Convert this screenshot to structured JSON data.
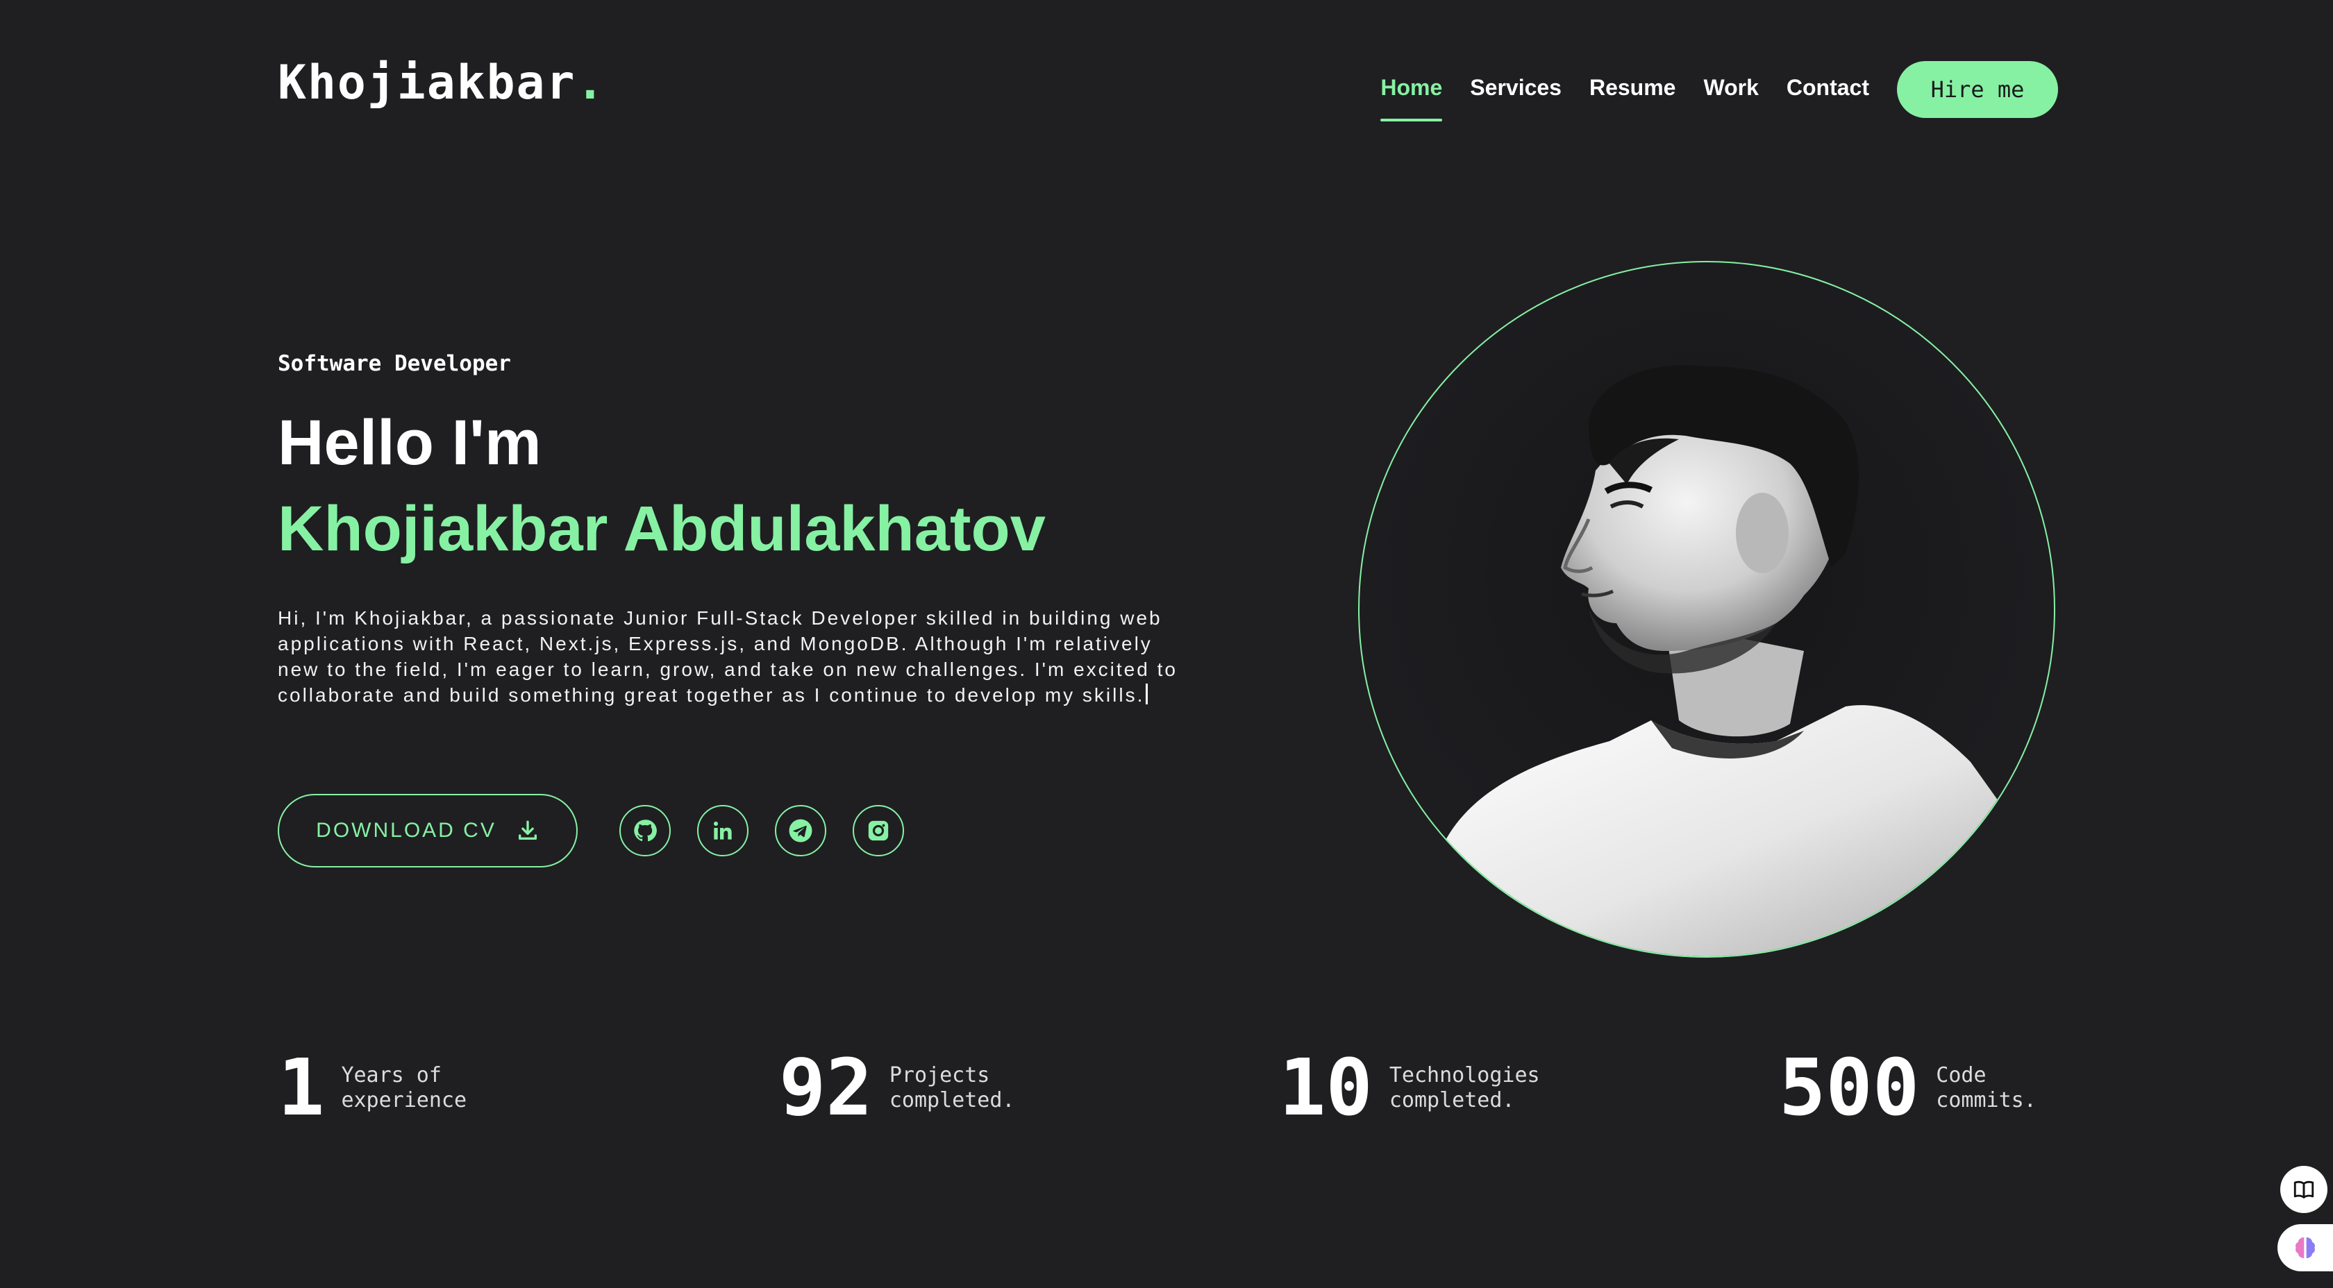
{
  "brand": {
    "name": "Khojiakbar",
    "dot": "."
  },
  "nav": {
    "items": [
      {
        "label": "Home",
        "active": true
      },
      {
        "label": "Services",
        "active": false
      },
      {
        "label": "Resume",
        "active": false
      },
      {
        "label": "Work",
        "active": false
      },
      {
        "label": "Contact",
        "active": false
      }
    ],
    "cta": "Hire me"
  },
  "hero": {
    "role": "Software Developer",
    "greeting": "Hello I'm",
    "name": "Khojiakbar Abdulakhatov",
    "bio": "Hi, I'm Khojiakbar, a passionate Junior Full-Stack Developer skilled in building web applications with React, Next.js, Express.js, and MongoDB. Although I'm relatively new to the field, I'm eager to learn, grow, and take on new challenges. I'm excited to collaborate and build something great together as I continue to develop my skills.",
    "download_label": "DOWNLOAD CV",
    "socials": [
      "github-icon",
      "linkedin-icon",
      "telegram-icon",
      "instagram-icon"
    ]
  },
  "stats": [
    {
      "value": "1",
      "label": "Years of\nexperience"
    },
    {
      "value": "92",
      "label": "Projects\ncompleted."
    },
    {
      "value": "10",
      "label": "Technologies\ncompleted."
    },
    {
      "value": "500",
      "label": "Code\ncommits."
    }
  ],
  "colors": {
    "background": "#1f1f22",
    "accent": "#86f1a3",
    "text": "#ffffff"
  }
}
